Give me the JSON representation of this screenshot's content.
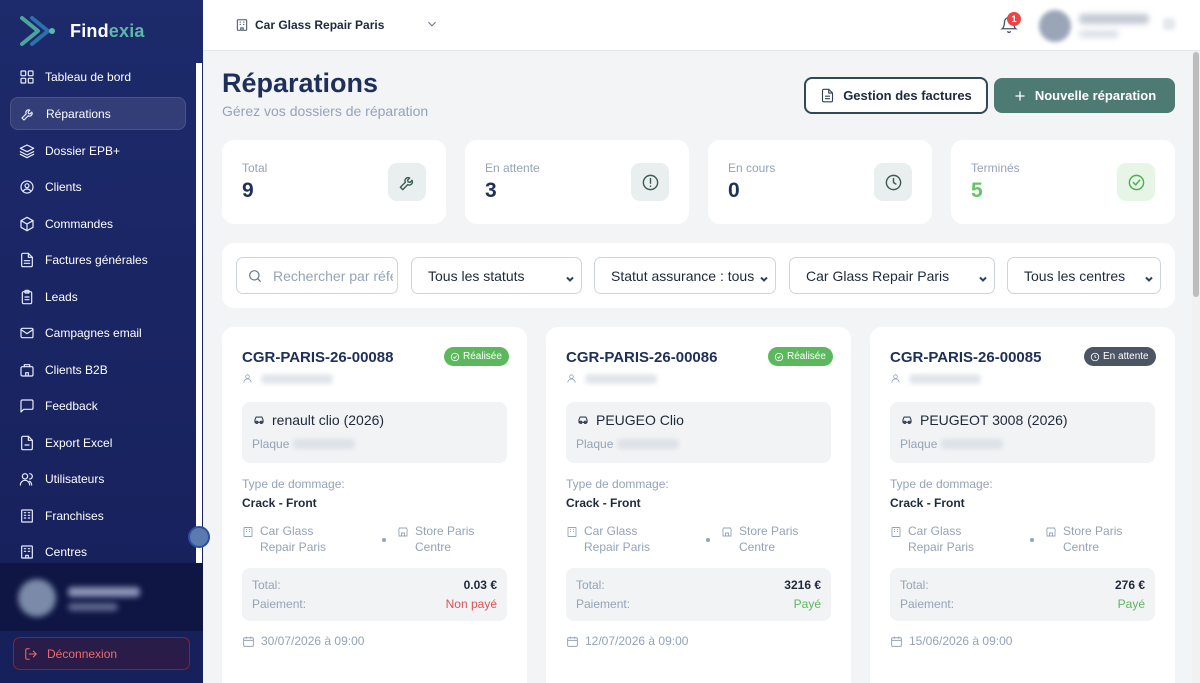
{
  "app": {
    "logo_prefix": "Find",
    "logo_suffix": "exia"
  },
  "sidebar": {
    "items": [
      {
        "label": "Tableau de bord",
        "icon": "dashboard-icon"
      },
      {
        "label": "Réparations",
        "icon": "wrench-icon",
        "active": true
      },
      {
        "label": "Dossier EPB+",
        "icon": "layers-icon"
      },
      {
        "label": "Clients",
        "icon": "user-circle-icon"
      },
      {
        "label": "Commandes",
        "icon": "package-icon"
      },
      {
        "label": "Factures générales",
        "icon": "file-text-icon"
      },
      {
        "label": "Leads",
        "icon": "clipboard-icon"
      },
      {
        "label": "Campagnes email",
        "icon": "mail-icon"
      },
      {
        "label": "Clients B2B",
        "icon": "building-icon"
      },
      {
        "label": "Feedback",
        "icon": "message-icon"
      },
      {
        "label": "Export Excel",
        "icon": "file-export-icon"
      },
      {
        "label": "Utilisateurs",
        "icon": "users-icon"
      },
      {
        "label": "Franchises",
        "icon": "franchise-icon"
      },
      {
        "label": "Centres",
        "icon": "building-2-icon"
      }
    ],
    "logout_label": "Déconnexion"
  },
  "topbar": {
    "organization": "Car Glass Repair Paris",
    "notification_count": "1"
  },
  "header": {
    "title": "Réparations",
    "subtitle": "Gérez vos dossiers de réparation",
    "invoices_button": "Gestion des factures",
    "new_button": "Nouvelle réparation"
  },
  "stats": [
    {
      "label": "Total",
      "value": "9",
      "icon": "wrench-icon"
    },
    {
      "label": "En attente",
      "value": "3",
      "icon": "alert-circle-icon"
    },
    {
      "label": "En cours",
      "value": "0",
      "icon": "clock-icon"
    },
    {
      "label": "Terminés",
      "value": "5",
      "icon": "check-circle-icon",
      "color": "#65c466"
    }
  ],
  "filters": {
    "search_placeholder": "Rechercher par référence",
    "status": "Tous les statuts",
    "insurance": "Statut assurance : tous",
    "organization": "Car Glass Repair Paris",
    "centers": "Tous les centres"
  },
  "repairs": [
    {
      "reference": "CGR-PARIS-26-00088",
      "status": "Réalisée",
      "vehicle": "renault clio (2026)",
      "plate_label": "Plaque",
      "damage_label": "Type de dommage:",
      "damage": "Crack - Front",
      "organization": "Car Glass Repair Paris",
      "center": "Store Paris Centre",
      "total_label": "Total:",
      "total": "0.03 €",
      "payment_label": "Paiement:",
      "payment": "Non payé",
      "date": "30/07/2026 à 09:00"
    },
    {
      "reference": "CGR-PARIS-26-00086",
      "status": "Réalisée",
      "vehicle": "PEUGEO Clio",
      "plate_label": "Plaque",
      "damage_label": "Type de dommage:",
      "damage": "Crack - Front",
      "organization": "Car Glass Repair Paris",
      "center": "Store Paris Centre",
      "total_label": "Total:",
      "total": "3216 €",
      "payment_label": "Paiement:",
      "payment": "Payé",
      "date": "12/07/2026 à 09:00"
    },
    {
      "reference": "CGR-PARIS-26-00085",
      "status": "En attente",
      "vehicle": "PEUGEOT 3008 (2026)",
      "plate_label": "Plaque",
      "damage_label": "Type de dommage:",
      "damage": "Crack - Front",
      "organization": "Car Glass Repair Paris",
      "center": "Store Paris Centre",
      "total_label": "Total:",
      "total": "276 €",
      "payment_label": "Paiement:",
      "payment": "Payé",
      "date": "15/06/2026 à 09:00"
    }
  ],
  "colors": {
    "sidebar": "#1d2a6b",
    "accent": "#4d7a72",
    "done": "#5cb85c",
    "waiting": "#4b5563",
    "unpaid": "#e05252"
  }
}
